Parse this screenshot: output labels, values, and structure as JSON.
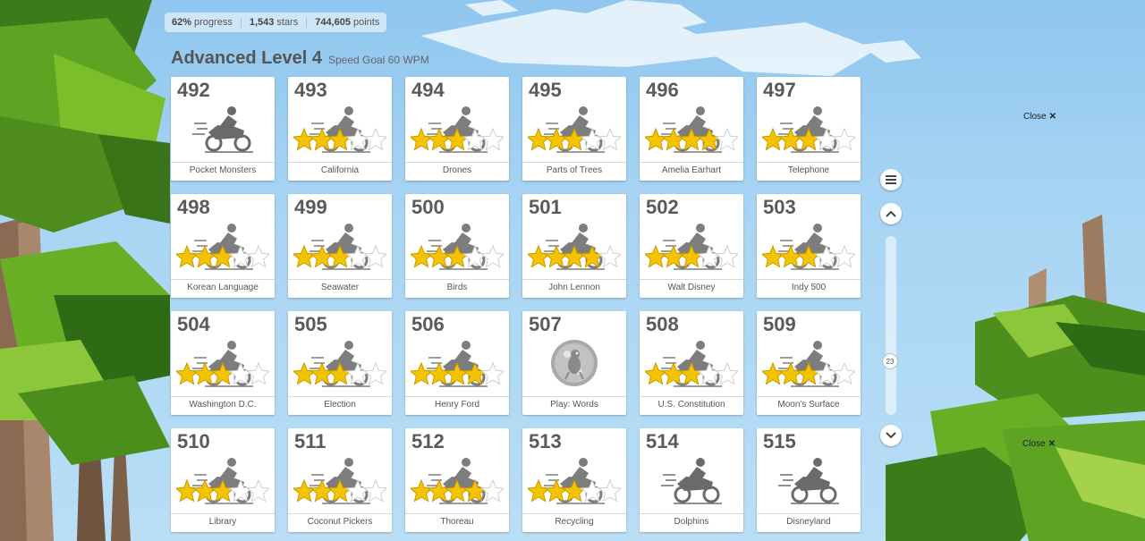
{
  "stats": {
    "progress_value": "62%",
    "progress_label": "progress",
    "stars_value": "1,543",
    "stars_label": "stars",
    "points_value": "744,605",
    "points_label": "points"
  },
  "level": {
    "title": "Advanced Level 4",
    "goal": "Speed Goal 60 WPM"
  },
  "lessons": [
    {
      "num": "492",
      "name": "Pocket Monsters",
      "stars": 0,
      "icon": "motorcycle-icon"
    },
    {
      "num": "493",
      "name": "California",
      "stars": 3,
      "icon": "motorcycle-icon"
    },
    {
      "num": "494",
      "name": "Drones",
      "stars": 3,
      "icon": "motorcycle-icon"
    },
    {
      "num": "495",
      "name": "Parts of Trees",
      "stars": 3,
      "icon": "motorcycle-icon"
    },
    {
      "num": "496",
      "name": "Amelia Earhart",
      "stars": 4,
      "icon": "motorcycle-icon"
    },
    {
      "num": "497",
      "name": "Telephone",
      "stars": 3,
      "icon": "motorcycle-icon"
    },
    {
      "num": "498",
      "name": "Korean Language",
      "stars": 3,
      "icon": "motorcycle-icon"
    },
    {
      "num": "499",
      "name": "Seawater",
      "stars": 3,
      "icon": "motorcycle-icon"
    },
    {
      "num": "500",
      "name": "Birds",
      "stars": 3,
      "icon": "motorcycle-icon"
    },
    {
      "num": "501",
      "name": "John Lennon",
      "stars": 4,
      "icon": "motorcycle-icon"
    },
    {
      "num": "502",
      "name": "Walt Disney",
      "stars": 3,
      "icon": "motorcycle-icon"
    },
    {
      "num": "503",
      "name": "Indy 500",
      "stars": 3,
      "icon": "motorcycle-icon"
    },
    {
      "num": "504",
      "name": "Washington D.C.",
      "stars": 3,
      "icon": "motorcycle-icon"
    },
    {
      "num": "505",
      "name": "Election",
      "stars": 3,
      "icon": "motorcycle-icon"
    },
    {
      "num": "506",
      "name": "Henry Ford",
      "stars": 4,
      "icon": "motorcycle-icon"
    },
    {
      "num": "507",
      "name": "Play: Words",
      "stars": null,
      "icon": "game-badge-icon"
    },
    {
      "num": "508",
      "name": "U.S. Constitution",
      "stars": 3,
      "icon": "motorcycle-icon"
    },
    {
      "num": "509",
      "name": "Moon's Surface",
      "stars": 3,
      "icon": "motorcycle-icon"
    },
    {
      "num": "510",
      "name": "Library",
      "stars": 3,
      "icon": "motorcycle-icon"
    },
    {
      "num": "511",
      "name": "Coconut Pickers",
      "stars": 3,
      "icon": "motorcycle-icon"
    },
    {
      "num": "512",
      "name": "Thoreau",
      "stars": 4,
      "icon": "motorcycle-icon"
    },
    {
      "num": "513",
      "name": "Recycling",
      "stars": 3,
      "icon": "motorcycle-icon"
    },
    {
      "num": "514",
      "name": "Dolphins",
      "stars": 0,
      "icon": "motorcycle-icon"
    },
    {
      "num": "515",
      "name": "Disneyland",
      "stars": 0,
      "icon": "motorcycle-icon"
    }
  ],
  "close_links": [
    "Close",
    "Close"
  ],
  "scroll": {
    "position_label": "23"
  },
  "colors": {
    "star_gold": "#f5c400",
    "star_empty": "#ffffff",
    "card_bg": "#ffffff",
    "sky": "#a9d5f4",
    "leaf": "#5f9e1e"
  }
}
